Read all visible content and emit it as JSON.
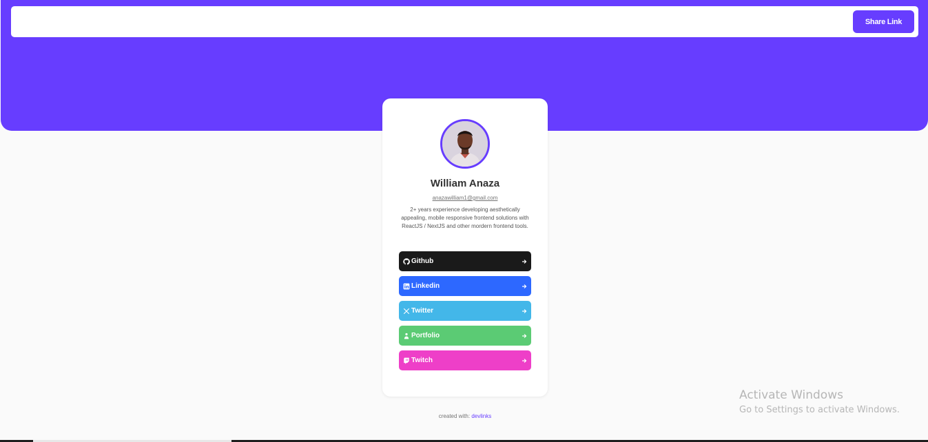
{
  "header": {
    "share_label": "Share Link"
  },
  "profile": {
    "name": "William Anaza",
    "email": "anazawilliam1@gmail.com",
    "bio": "2+ years experience developing aesthetically appealing, mobile responsive frontend solutions with ReactJS / NextJS and other mordern frontend tools."
  },
  "links": [
    {
      "label": "Github",
      "icon": "github-icon",
      "color": "#1a1a1a"
    },
    {
      "label": "Linkedin",
      "icon": "linkedin-icon",
      "color": "#2d68ff"
    },
    {
      "label": "Twitter",
      "icon": "x-twitter-icon",
      "color": "#43b7e9"
    },
    {
      "label": "Portfolio",
      "icon": "portfolio-icon",
      "color": "#5bcb74"
    },
    {
      "label": "Twitch",
      "icon": "twitch-icon",
      "color": "#ee3fc8"
    }
  ],
  "footer": {
    "prefix": "created with:",
    "brand": "devlinks"
  },
  "watermark": {
    "title": "Activate Windows",
    "subtitle": "Go to Settings to activate Windows."
  },
  "colors": {
    "accent": "#673dff",
    "background": "#fafafa"
  }
}
